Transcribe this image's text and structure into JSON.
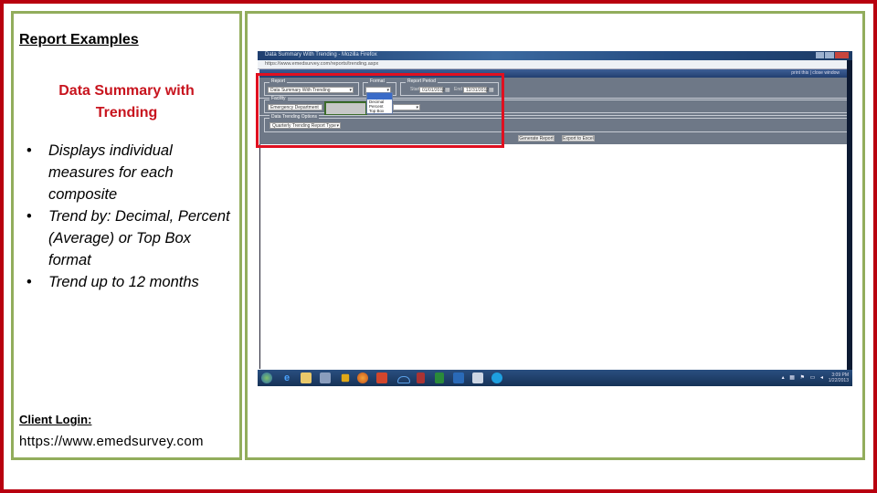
{
  "left_panel": {
    "heading": "Report Examples",
    "subtitle_line1": "Data Summary with",
    "subtitle_line2": "Trending",
    "bullets": [
      "Displays individual measures for each composite",
      "Trend by: Decimal, Percent (Average) or Top Box format",
      "Trend up to 12 months"
    ],
    "bullet_glyph": "•",
    "login_label": "Client Login:",
    "login_url": "https://www.emedsurvey.com"
  },
  "screenshot": {
    "window_title": "Data Summary With Trending - Mozilla Firefox",
    "address": "https://www.emedsurvey.com/reports/trending.aspx",
    "header_right": "print this | close window",
    "report_legend": "Report",
    "report_value": "Data Summary With Trending",
    "format_legend": "Format",
    "format_options": [
      "Decimal",
      "Percent",
      "Top Box"
    ],
    "period_legend": "Report Period",
    "start_label": "Start",
    "start_value": "01/01/2012",
    "end_label": "End",
    "end_value": "12/31/2012",
    "facility_legend": "Facility",
    "facility_value": "Emergency Department",
    "trending_legend": "Data Trending Options",
    "trending_value": "Quarterly Trending Report Type",
    "generate_button": "Generate Report",
    "export_button": "Export to Excel",
    "tray_time": "3:09 PM",
    "tray_date": "1/22/2013",
    "taskbar_icons": [
      "start-orb",
      "internet-explorer",
      "file-explorer",
      "paint",
      "media-player",
      "firefox",
      "powerpoint",
      "onedrive",
      "access",
      "excel",
      "outlook",
      "notepad",
      "skype"
    ]
  },
  "colors": {
    "outer_border": "#b8000f",
    "panel_border": "#92ad5c",
    "subtitle": "#c8141e",
    "highlight_box": "#e01020",
    "app_bg": "#6e7887"
  }
}
